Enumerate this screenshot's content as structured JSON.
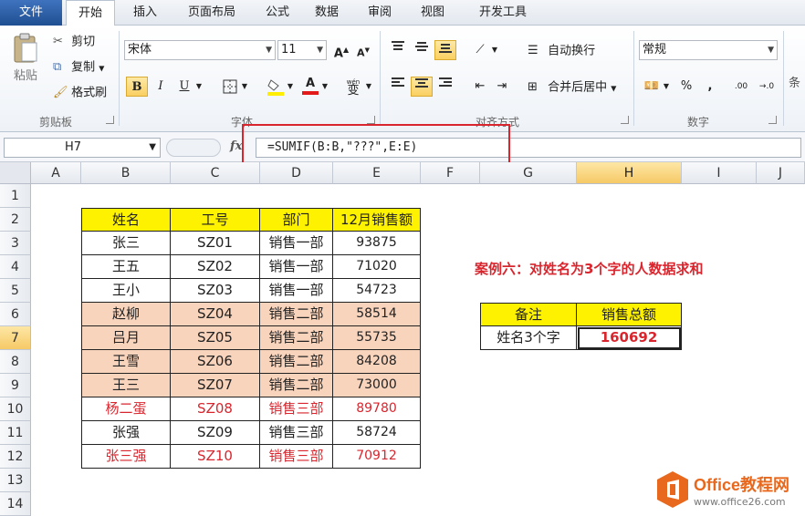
{
  "tabs": [
    "文件",
    "开始",
    "插入",
    "页面布局",
    "公式",
    "数据",
    "审阅",
    "视图",
    "开发工具"
  ],
  "active_tab": "开始",
  "clipboard": {
    "paste": "粘贴",
    "cut": "剪切",
    "copy": "复制",
    "format_painter": "格式刷",
    "group": "剪贴板"
  },
  "font": {
    "name": "宋体",
    "size": "11",
    "group": "字体",
    "bold": "B",
    "italic": "I",
    "underline": "U",
    "wen": "wén"
  },
  "alignment": {
    "wrap_text": "自动换行",
    "merge_center": "合并后居中",
    "group": "对齐方式"
  },
  "number": {
    "format": "常规",
    "group": "数字",
    "percent": "%",
    "comma": ",",
    "inc_decimal": ".00",
    "dec_decimal": "→.0"
  },
  "styles": {
    "conditional": "条"
  },
  "formula_bar": {
    "name_box": "H7",
    "fx": "fx",
    "formula": "=SUMIF(B:B,\"???\",E:E)"
  },
  "columns": [
    "A",
    "B",
    "C",
    "D",
    "E",
    "F",
    "G",
    "H",
    "I",
    "J"
  ],
  "selected_column": "H",
  "rows": [
    "1",
    "2",
    "3",
    "4",
    "5",
    "6",
    "7",
    "8",
    "9",
    "10",
    "11",
    "12",
    "13",
    "14"
  ],
  "selected_row": "7",
  "table": {
    "headers": [
      "姓名",
      "工号",
      "部门",
      "12月销售额"
    ],
    "rows": [
      {
        "name": "张三",
        "id": "SZ01",
        "dept": "销售一部",
        "sales": "93875",
        "style": "plain"
      },
      {
        "name": "王五",
        "id": "SZ02",
        "dept": "销售一部",
        "sales": "71020",
        "style": "plain"
      },
      {
        "name": "王小",
        "id": "SZ03",
        "dept": "销售一部",
        "sales": "54723",
        "style": "plain"
      },
      {
        "name": "赵柳",
        "id": "SZ04",
        "dept": "销售二部",
        "sales": "58514",
        "style": "pink"
      },
      {
        "name": "吕月",
        "id": "SZ05",
        "dept": "销售二部",
        "sales": "55735",
        "style": "pink"
      },
      {
        "name": "王雪",
        "id": "SZ06",
        "dept": "销售二部",
        "sales": "84208",
        "style": "pink"
      },
      {
        "name": "王三",
        "id": "SZ07",
        "dept": "销售二部",
        "sales": "73000",
        "style": "pink"
      },
      {
        "name": "杨二蛋",
        "id": "SZ08",
        "dept": "销售三部",
        "sales": "89780",
        "style": "red"
      },
      {
        "name": "张强",
        "id": "SZ09",
        "dept": "销售三部",
        "sales": "58724",
        "style": "plain"
      },
      {
        "name": "张三强",
        "id": "SZ10",
        "dept": "销售三部",
        "sales": "70912",
        "style": "red"
      }
    ]
  },
  "example_title": "案例六：对姓名为3个字的人数据求和",
  "result_table": {
    "headers": [
      "备注",
      "销售总额"
    ],
    "label": "姓名3个字",
    "value": "160692"
  },
  "watermark": {
    "title": "Office教程网",
    "url": "www.office26.com"
  },
  "colors": {
    "header_yellow": "#fff200",
    "highlight_pink": "#f9d4bd",
    "accent_red": "#d9262e",
    "file_tab_blue": "#2a5a9e"
  }
}
